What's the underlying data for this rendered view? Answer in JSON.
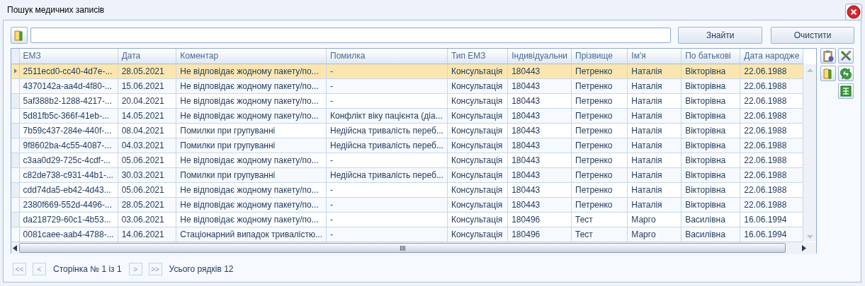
{
  "window": {
    "title": "Пошук медичних записів"
  },
  "search": {
    "buttons": [
      "Знайти",
      "Очистити"
    ]
  },
  "table": {
    "columns": [
      "ЕМЗ",
      "Дата",
      "Коментар",
      "Помилка",
      "Тип ЕМЗ",
      "Індивідуальни",
      "Прізвище",
      "Ім'я",
      "По батькові",
      "Дата народже"
    ],
    "rows": [
      {
        "selected": true,
        "cells": [
          "2511ecd0-cc40-4d7e-...",
          "28.05.2021",
          "Не відповідає жодному пакету/по...",
          "-",
          "Консультація",
          "180443",
          "Петренко",
          "Наталія",
          "Вікторівна",
          "22.06.1988"
        ]
      },
      {
        "selected": false,
        "cells": [
          "4370142a-aa4d-4f80-...",
          "15.06.2021",
          "Не відповідає жодному пакету/по...",
          "-",
          "Консультація",
          "180443",
          "Петренко",
          "Наталія",
          "Вікторівна",
          "22.06.1988"
        ]
      },
      {
        "selected": false,
        "cells": [
          "5af388b2-1288-4217-...",
          "20.04.2021",
          "Не відповідає жодному пакету/по...",
          "-",
          "Консультація",
          "180443",
          "Петренко",
          "Наталія",
          "Вікторівна",
          "22.06.1988"
        ]
      },
      {
        "selected": false,
        "cells": [
          "5d81fb5c-366f-41eb-...",
          "14.05.2021",
          "Не відповідає жодному пакету/по...",
          "Конфлікт віку пацієнта (діа...",
          "Консультація",
          "180443",
          "Петренко",
          "Наталія",
          "Вікторівна",
          "22.06.1988"
        ]
      },
      {
        "selected": false,
        "cells": [
          "7b59c437-284e-440f-...",
          "08.04.2021",
          "Помилки при групуванні",
          "Недійсна тривалість переб...",
          "Консультація",
          "180443",
          "Петренко",
          "Наталія",
          "Вікторівна",
          "22.06.1988"
        ]
      },
      {
        "selected": false,
        "cells": [
          "9f8602ba-4c55-4087-...",
          "04.03.2021",
          "Помилки при групуванні",
          "Недійсна тривалість переб...",
          "Консультація",
          "180443",
          "Петренко",
          "Наталія",
          "Вікторівна",
          "22.06.1988"
        ]
      },
      {
        "selected": false,
        "cells": [
          "c3aa0d29-725c-4cdf-...",
          "05.06.2021",
          "Не відповідає жодному пакету/по...",
          "-",
          "Консультація",
          "180443",
          "Петренко",
          "Наталія",
          "Вікторівна",
          "22.06.1988"
        ]
      },
      {
        "selected": false,
        "cells": [
          "c82de738-c931-44b1-...",
          "30.03.2021",
          "Помилки при групуванні",
          "Недійсна тривалість переб...",
          "Консультація",
          "180443",
          "Петренко",
          "Наталія",
          "Вікторівна",
          "22.06.1988"
        ]
      },
      {
        "selected": false,
        "cells": [
          "cdd74da5-eb42-4d43...",
          "05.06.2021",
          "Не відповідає жодному пакету/по...",
          "-",
          "Консультація",
          "180443",
          "Петренко",
          "Наталія",
          "Вікторівна",
          "22.06.1988"
        ]
      },
      {
        "selected": false,
        "cells": [
          "2380f669-552d-4496-...",
          "28.05.2021",
          "Не відповідає жодному пакету/по...",
          "-",
          "Консультація",
          "180443",
          "Петренко",
          "Наталія",
          "Вікторівна",
          "22.06.1988"
        ]
      },
      {
        "selected": false,
        "cells": [
          "da218729-60c1-4b53...",
          "03.06.2021",
          "Не відповідає жодному пакету/по...",
          "-",
          "Консультація",
          "180496",
          "Тест",
          "Марго",
          "Василівна",
          "16.06.1994"
        ]
      },
      {
        "selected": false,
        "cells": [
          "0081caee-aab4-4788-...",
          "14.06.2021",
          "Стаціонарний випадок тривалістю...",
          "-",
          "Консультація",
          "180496",
          "Тест",
          "Марго",
          "Василівна",
          "16.06.1994"
        ]
      }
    ]
  },
  "pager": {
    "first": {
      "label": "<<",
      "disabled": true
    },
    "prev": {
      "label": "<",
      "disabled": true
    },
    "page_text": "Сторінка № 1 із 1",
    "next": {
      "label": ">",
      "disabled": true
    },
    "last": {
      "label": ">>",
      "disabled": true
    },
    "total_text": "Усього рядків 12"
  }
}
